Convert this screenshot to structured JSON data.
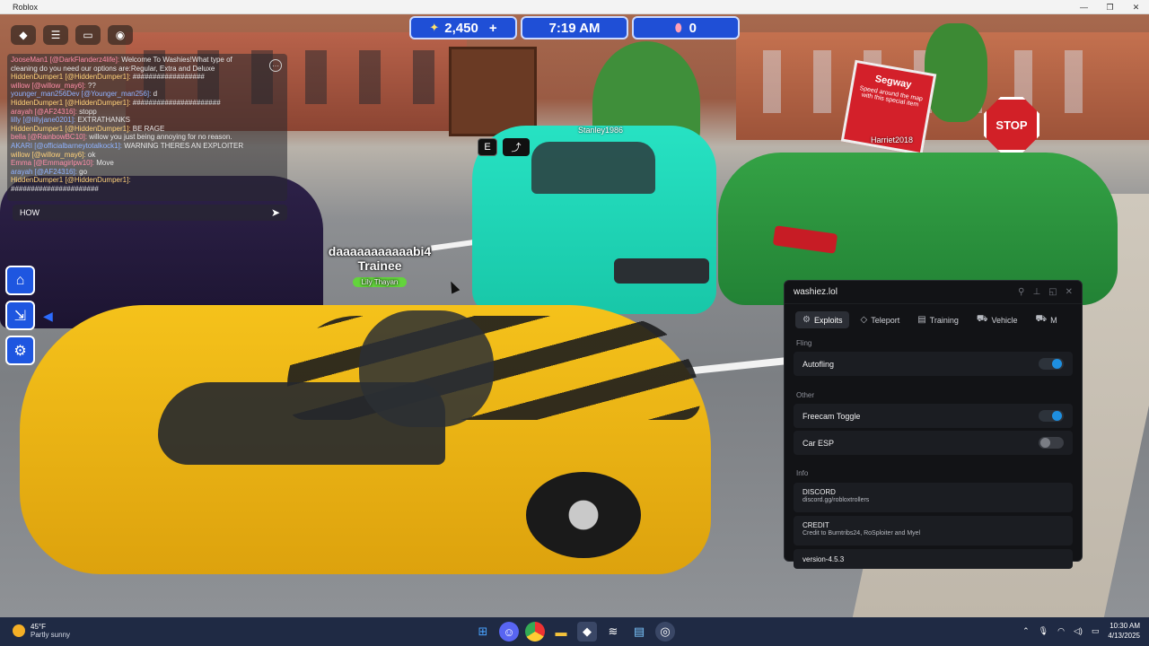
{
  "window": {
    "title": "Roblox",
    "controls": [
      "—",
      "❐",
      "✕"
    ]
  },
  "hud": {
    "cash": "2,450",
    "cash_plus": "+",
    "time": "7:19 AM",
    "gems": "0"
  },
  "chat": {
    "lines": [
      {
        "who": "JooseMan1 [@DarkFlanderz4life]:",
        "msg": " Welcome To Washies!What type of"
      },
      {
        "who": "",
        "msg": "cleaning do you need our options are:Regular, Extra and Deluxe"
      },
      {
        "who": "HiddenDumper1 [@HiddenDumper1]:",
        "msg": " ##################"
      },
      {
        "who": "willow [@willow_may6]:",
        "msg": " ??"
      },
      {
        "who": "younger_man256Dev [@Younger_man256]:",
        "msg": " d"
      },
      {
        "who": "HiddenDumper1 [@HiddenDumper1]:",
        "msg": " ######################"
      },
      {
        "who": "arayah [@AF24316]:",
        "msg": " stopp"
      },
      {
        "who": "lilly [@lillyjane0201]:",
        "msg": " EXTRATHANKS"
      },
      {
        "who": "HiddenDumper1 [@HiddenDumper1]:",
        "msg": " BE RAGE"
      },
      {
        "who": "bella [@RainbowBC10]:",
        "msg": " willow you just being annoying for no reason."
      },
      {
        "who": "AKARI [@officialbarneytotalkock1]:",
        "msg": " WARNING THERES AN EXPLOITER"
      },
      {
        "who": "willow [@willow_may6]:",
        "msg": " ok"
      },
      {
        "who": "Emma [@Emmagirlpw10]:",
        "msg": " Move"
      },
      {
        "who": "arayah [@AF24316]:",
        "msg": " go"
      },
      {
        "who": "HiddenDumper1 [@HiddenDumper1]:",
        "msg": ""
      },
      {
        "who": "",
        "msg": "######################"
      }
    ],
    "input_value": "HOW"
  },
  "nametag": {
    "name": "daaaaaaaaaaabi4",
    "rank": "Trainee",
    "sub": "Lily Thayan"
  },
  "player_tags": {
    "p1": "Stanley1986",
    "p2": "Harriet2018"
  },
  "keys": {
    "e": "E"
  },
  "sign": {
    "title": "Segway",
    "text": "Speed around the map with this special item"
  },
  "stop_sign": "STOP",
  "panel": {
    "title": "washiez.lol",
    "tabs": [
      {
        "label": "Exploits",
        "icon": "⚙",
        "active": true
      },
      {
        "label": "Teleport",
        "icon": "◇",
        "active": false
      },
      {
        "label": "Training",
        "icon": "▤",
        "active": false
      },
      {
        "label": "Vehicle",
        "icon": "⛟",
        "active": false
      },
      {
        "label": "M",
        "icon": "⛟",
        "active": false
      }
    ],
    "sections": {
      "fling": "Fling",
      "autofling": "Autofling",
      "other": "Other",
      "freecam": "Freecam Toggle",
      "caresp": "Car ESP",
      "info": "Info",
      "discord_title": "DISCORD",
      "discord_link": "discord.gg/robloxtrollers",
      "credit_title": "CREDIT",
      "credit_text": "Credit to Burntribs24, RoSploiter and Myel",
      "version": "version-4.5.3"
    },
    "toggles": {
      "autofling": true,
      "freecam": true,
      "caresp": false
    }
  },
  "taskbar": {
    "temp": "45°F",
    "weather": "Partly sunny",
    "time": "10:30 AM",
    "date": "4/13/2025"
  },
  "colors": {
    "hud_blue": "#1f4fd6",
    "toggle_on": "#1e8fe0",
    "panel_bg": "#121316",
    "taskbar": "#1f2a44"
  }
}
